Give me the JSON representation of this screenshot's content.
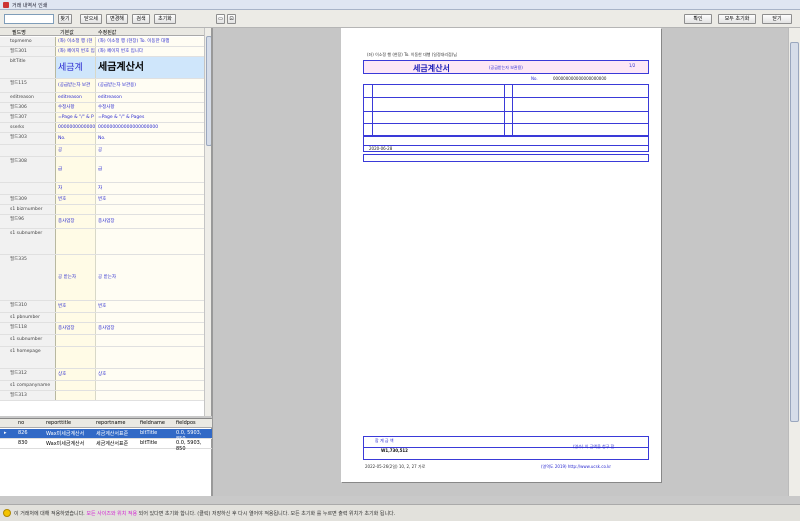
{
  "window": {
    "title": "거래 내역서 인쇄"
  },
  "left_toolbar": {
    "search_value": "",
    "buttons": [
      "찾기",
      "닫으세",
      "변경해",
      "검색",
      "초기화"
    ]
  },
  "grid": {
    "headers": [
      "필드명",
      "기본값",
      "수정된값"
    ],
    "rows": [
      {
        "field": "topmemo",
        "def": "(좌) 이소정 행 (현장)",
        "mod": "(좌) 이소정 행 (현장)  To. 이동한 대행"
      },
      {
        "field": "필드301",
        "def": "(좌) 페이지 번호 입니다",
        "mod": "(좌) 페이지 번호 입니다"
      },
      {
        "field": "bltTitle",
        "def": "세금계",
        "mod": "세금계산서"
      },
      {
        "field": "필드115",
        "def": "(공급받는자 보관용)",
        "mod": "(공급받는자 보관용)"
      },
      {
        "field": "editreason",
        "def": "editreason",
        "mod": "editreason"
      },
      {
        "field": "필드306",
        "def": "수정사항",
        "mod": "수정사항"
      },
      {
        "field": "필드307",
        "def": "=Page & \"/\" & P",
        "mod": "=Page & \"/\" & Pages"
      },
      {
        "field": "sserks",
        "def": "000000000000000000000",
        "mod": "000000000000000000000"
      },
      {
        "field": "필드303",
        "def": "No.",
        "mod": "No."
      },
      {
        "field": "",
        "def": "공",
        "mod": "공"
      },
      {
        "field": "필드308",
        "def": "급",
        "mod": "급"
      },
      {
        "field": "",
        "def": "자",
        "mod": "자"
      },
      {
        "field": "필드309",
        "def": "번호",
        "mod": "번호"
      },
      {
        "field": "s1 bizrnumber",
        "def": "",
        "mod": ""
      },
      {
        "field": "필드96",
        "def": "종사업장",
        "mod": "종사업장"
      },
      {
        "field": "s1 subnumber",
        "def": "",
        "mod": ""
      },
      {
        "field": "필드335",
        "def": "공 받는자",
        "mod": "공 받는자"
      },
      {
        "field": "필드310",
        "def": "번호",
        "mod": "번호"
      },
      {
        "field": "s1 pbnumber",
        "def": "",
        "mod": ""
      },
      {
        "field": "필드118",
        "def": "종사업장",
        "mod": "종사업장"
      },
      {
        "field": "s1 subnumber",
        "def": "",
        "mod": ""
      },
      {
        "field": "s1 homepage",
        "def": "",
        "mod": ""
      },
      {
        "field": "필드312",
        "def": "상호",
        "mod": "상호"
      },
      {
        "field": "s1 companyname",
        "def": "",
        "mod": ""
      },
      {
        "field": "필드313",
        "def": "",
        "mod": ""
      }
    ]
  },
  "list": {
    "headers": [
      "no",
      "reporttitle",
      "reportname",
      "fieldname",
      "fieldpos"
    ],
    "rows": [
      {
        "no": "826",
        "title": "Wax미세금계산서",
        "name": "세금계산서표준",
        "field": "bltTitle",
        "pos": "0.0, 5903, 850"
      },
      {
        "no": "830",
        "title": "Wax미세금계산서",
        "name": "세금계산서표준",
        "field": "bltTitle",
        "pos": "0.0, 5903, 850"
      }
    ]
  },
  "right_toolbar": {
    "buttons": [
      "확인",
      "모두 초기화",
      "닫기"
    ]
  },
  "paper": {
    "header_line": "(좌) 이소정 행 (현장)  To. 이동한 대행 (일정대리점)님",
    "page_num": "1/2",
    "title": "세금계산서",
    "subtitle": "(공급받는자 보관용)",
    "no_label": "No.",
    "no_value": "000000000000000000000",
    "date": "2020-06-28",
    "sum_label": "합 계 금 액",
    "total": "W1,730,512",
    "footer_left": "2022-05-26(2일) 10, 2, 27 가로",
    "footer_right": "(영수) 이 금액을 청구 함.",
    "website": "(영역도 2019) http://www.ucsk.co.kr"
  },
  "status": {
    "message_a": "이 거래처에 대해 적용하였습니다.",
    "message_b": "모든 사이즈와 위치 적용",
    "message_c": "되어 있다면 초기화 합니다. (클릭) 저장하신 후 다시 열어야 적용됩니다. 모든 초기화 를 누르면 출력 위치가 초기화 됩니다."
  }
}
